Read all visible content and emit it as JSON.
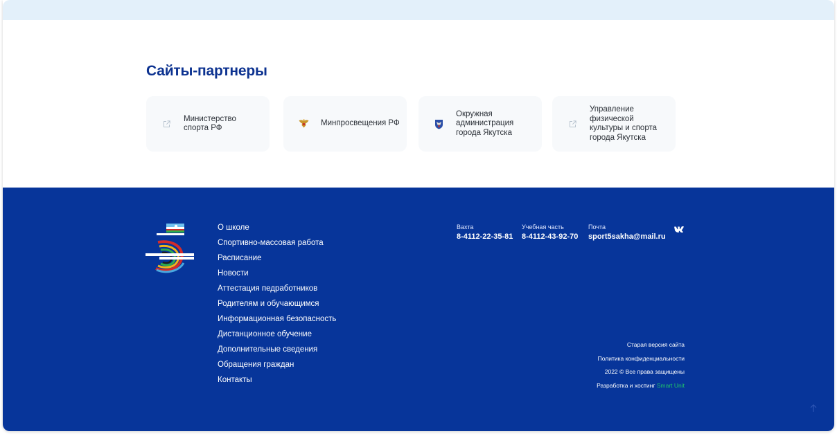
{
  "partners": {
    "title": "Сайты-партнеры",
    "cards": [
      {
        "label": "Министерство спорта РФ",
        "icon": "external-link-icon"
      },
      {
        "label": "Минпросвещения РФ",
        "icon": "eagle-emblem-icon"
      },
      {
        "label": "Окружная администрация города Якутска",
        "icon": "yakutsk-emblem-icon"
      },
      {
        "label": "Управление физической культуры и спорта города Якутска",
        "icon": "external-link-icon"
      }
    ]
  },
  "footer": {
    "nav": [
      "О школе",
      "Спортивно-массовая работа",
      "Расписание",
      "Новости",
      "Аттестация педработников",
      "Родителям и обучающимся",
      "Информационная безопасность",
      "Дистанционное обучение",
      "Дополнительные сведения",
      "Обращения граждан",
      "Контакты"
    ],
    "contacts": [
      {
        "caption": "Вахта",
        "value": "8-4112-22-35-81"
      },
      {
        "caption": "Учебная часть",
        "value": "8-4112-43-92-70"
      },
      {
        "caption": "Почта",
        "value": "sport5sakha@mail.ru"
      }
    ],
    "vk_label": "VK",
    "legal": {
      "old_site": "Старая версия сайта",
      "privacy": "Политика конфиденциальности",
      "copyright": "2022 © Все права защищены",
      "dev_prefix": "Разработка и хостинг",
      "dev_name": "Smart Unit"
    }
  },
  "colors": {
    "footer_bg": "#07359a",
    "title": "#0c3290",
    "card_bg": "#f7f9fb",
    "accent_green": "#1ec26a"
  }
}
